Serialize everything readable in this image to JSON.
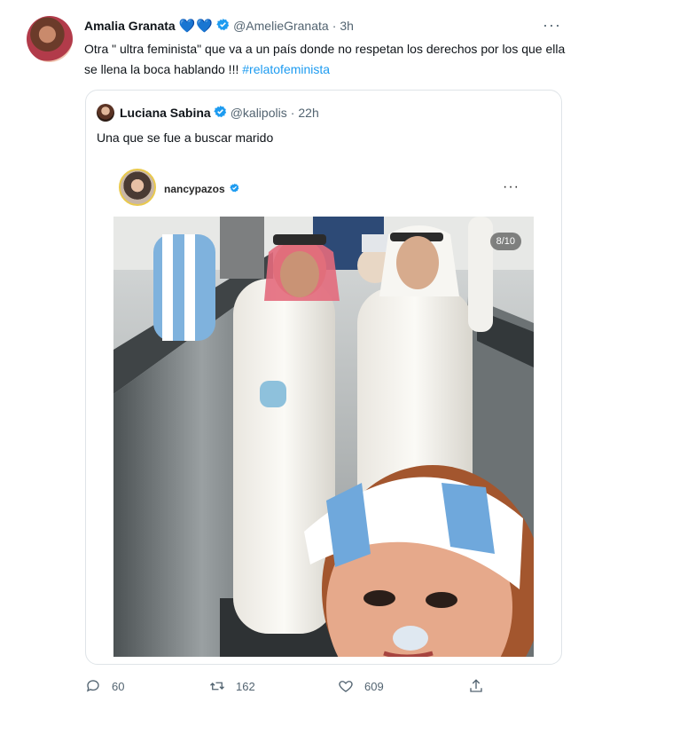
{
  "tweet": {
    "author_name": "Amalia Granata",
    "emoji": [
      "💙",
      "💙"
    ],
    "handle": "@AmelieGranata",
    "separator": "·",
    "time": "3h",
    "more": "···",
    "text_part1": "Otra \" ultra feminista\" que va a un país donde no respetan los derechos por los que ella se llena la boca hablando !!! ",
    "hashtag": "#relatofeminista"
  },
  "quote": {
    "author_name": "Luciana Sabina",
    "handle": "@kalipolis",
    "separator": "·",
    "time": "22h",
    "text": "Una que se fue a buscar marido",
    "embed": {
      "username": "nancypazos",
      "more": "···",
      "counter": "8/10"
    }
  },
  "actions": {
    "replies": "60",
    "retweets": "162",
    "likes": "609"
  },
  "colors": {
    "link": "#1d9bf0",
    "muted": "#536471",
    "verified": "#1d9bf0",
    "argentina_blue": "#6fa8dc"
  },
  "icons": [
    "verified-icon",
    "more-icon",
    "reply-icon",
    "retweet-icon",
    "like-icon",
    "share-icon"
  ]
}
